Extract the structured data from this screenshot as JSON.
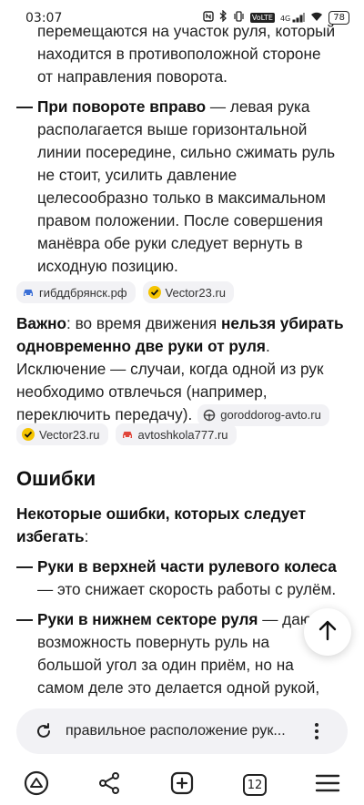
{
  "status_bar": {
    "time": "03:07",
    "icons": [
      "nfc-icon",
      "bluetooth-icon",
      "vibrate-icon",
      "volte-icon",
      "signal-4g-icon",
      "wifi-icon"
    ],
    "volte": "VoLTE",
    "net": "4G",
    "battery": "78"
  },
  "article": {
    "bullet1_lines": [
      "перемещаются на участок руля, который",
      "находится в противоположной стороне",
      "от направления поворота."
    ],
    "bullet2": {
      "bold": "При повороте вправо",
      "lines": [
        " — левая рука",
        "располагается выше горизонтальной",
        "линии посередине, сильно сжимать руль",
        "не стоит, усилить давление",
        "целесообразно только в максимальном",
        "правом положении. После совершения",
        "манёвра обе руки следует вернуть в",
        "исходную позицию."
      ]
    },
    "sources1": [
      "гибддбрянск.рф",
      "Vector23.ru"
    ],
    "important": {
      "bold1": "Важно",
      "text1": ": во время движения ",
      "bold2": "нельзя убирать",
      "bold3": "одновременно две руки от руля",
      "text2": ".",
      "line3": "Исключение — случаи, когда одной из рук",
      "line4": "необходимо отвлечься (например,",
      "line5": "переключить передачу).",
      "inline_source": "goroddorog-avto.ru"
    },
    "sources2": [
      "Vector23.ru",
      "avtoshkola777.ru"
    ],
    "errors_heading": "Ошибки",
    "intro_bold_1": "Некоторые ошибки, которых следует",
    "intro_bold_2": "избегать",
    "intro_colon": ":",
    "err1": {
      "bold": "Руки в верхней части рулевого колеса",
      "rest": "— это снижает скорость работы с рулём."
    },
    "err2": {
      "bold": "Руки в нижнем секторе руля",
      "lines": [
        " — дают",
        "возможность повернуть руль на",
        "большой угол за один приём, но на",
        "самом деле это делается одной рукой,"
      ]
    }
  },
  "search": {
    "query": "правильное расположение рук..."
  },
  "nav": {
    "tabs_count": "12"
  },
  "colors": {
    "accent_yellow": "#f5c400",
    "chip_bg": "#f2f2f5",
    "car_red": "#e0453a",
    "car_blue": "#3b6fd6"
  }
}
